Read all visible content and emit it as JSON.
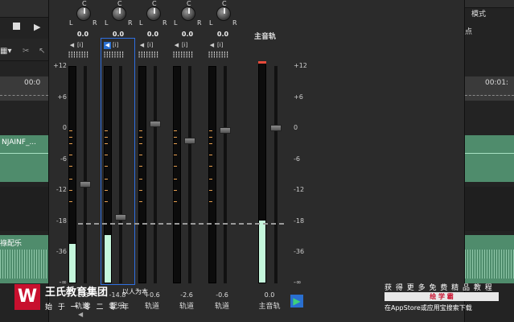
{
  "background": {
    "left": {
      "timecode": "00:0",
      "clip1_label": "NJAINF_...",
      "clip2_label": "祿配乐"
    },
    "right": {
      "mode_label": "模式",
      "point_label": "点",
      "timecode": "00:01:"
    }
  },
  "mixer": {
    "scale_left": [
      "+12",
      "+6",
      "0",
      "-6",
      "-12",
      "-18",
      "-36",
      "-∞"
    ],
    "scale_right": [
      "+12",
      "+6",
      "0",
      "-6",
      "-12",
      "-18",
      "-36",
      "-∞"
    ],
    "strips": [
      {
        "pan": "0.0",
        "vol": "-5.6",
        "name": "轨道",
        "selected": false,
        "fill": 0.18,
        "fader": 0.53
      },
      {
        "pan": "0.0",
        "vol": "-14.8",
        "name": "配乐",
        "selected": true,
        "fill": 0.22,
        "fader": 0.68
      },
      {
        "pan": "0.0",
        "vol": "+0.6",
        "name": "轨道",
        "selected": false,
        "fill": 0,
        "fader": 0.25
      },
      {
        "pan": "0.0",
        "vol": "-2.6",
        "name": "轨道",
        "selected": false,
        "fill": 0,
        "fader": 0.33
      },
      {
        "pan": "0.0",
        "vol": "-0.6",
        "name": "轨道",
        "selected": false,
        "fill": 0,
        "fader": 0.28
      }
    ],
    "master": {
      "title": "主音轨",
      "vol": "0.0",
      "name": "主音轨",
      "fill": 0.28,
      "fader": 0.27
    }
  },
  "watermark": {
    "brand": "王氏教育集团",
    "motto": "以人为本",
    "slogan": "始 于 一 零 二 零 年",
    "promo1": "获 得 更 多 免 费 精 品 教 程",
    "promo_badge": "绘 学 霸",
    "promo2": "在AppStore或应用宝搜索下载"
  }
}
